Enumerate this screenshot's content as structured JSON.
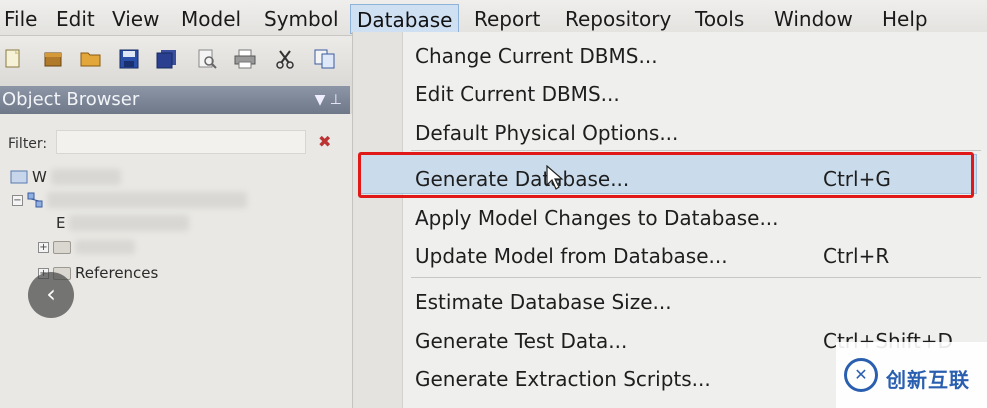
{
  "menubar": {
    "items": [
      "File",
      "Edit",
      "View",
      "Model",
      "Symbol",
      "Database",
      "Report",
      "Repository",
      "Tools",
      "Window",
      "Help"
    ],
    "active": "Database"
  },
  "toolbar": {
    "icons": [
      "new-icon",
      "open-package-icon",
      "open-folder-icon",
      "save-icon",
      "save-all-icon",
      "print-preview-icon",
      "print-icon",
      "cut-icon",
      "copy-icon"
    ]
  },
  "object_browser": {
    "title": "Object Browser",
    "filter_label": "Filter:",
    "filter_value": "",
    "tree": {
      "root_label": "W",
      "model_label": "E",
      "references_label": "References"
    }
  },
  "database_menu": {
    "items": [
      {
        "label": "Change Current DBMS...",
        "shortcut": ""
      },
      {
        "label": "Edit Current DBMS...",
        "shortcut": ""
      },
      {
        "label": "Default Physical Options...",
        "shortcut": ""
      },
      {
        "label": "Generate Database...",
        "shortcut": "Ctrl+G"
      },
      {
        "label": "Apply Model Changes to Database...",
        "shortcut": ""
      },
      {
        "label": "Update Model from Database...",
        "shortcut": "Ctrl+R"
      },
      {
        "label": "Estimate Database Size...",
        "shortcut": ""
      },
      {
        "label": "Generate Test Data...",
        "shortcut": "Ctrl+Shift+D"
      },
      {
        "label": "Generate Extraction Scripts...",
        "shortcut": ""
      }
    ],
    "highlighted": "Generate Database..."
  },
  "watermark": {
    "text": "创新互联",
    "colors": {
      "brand": "#2a5fb0"
    }
  },
  "colors": {
    "highlight": "#cadcec",
    "annotation": "#e01818"
  }
}
